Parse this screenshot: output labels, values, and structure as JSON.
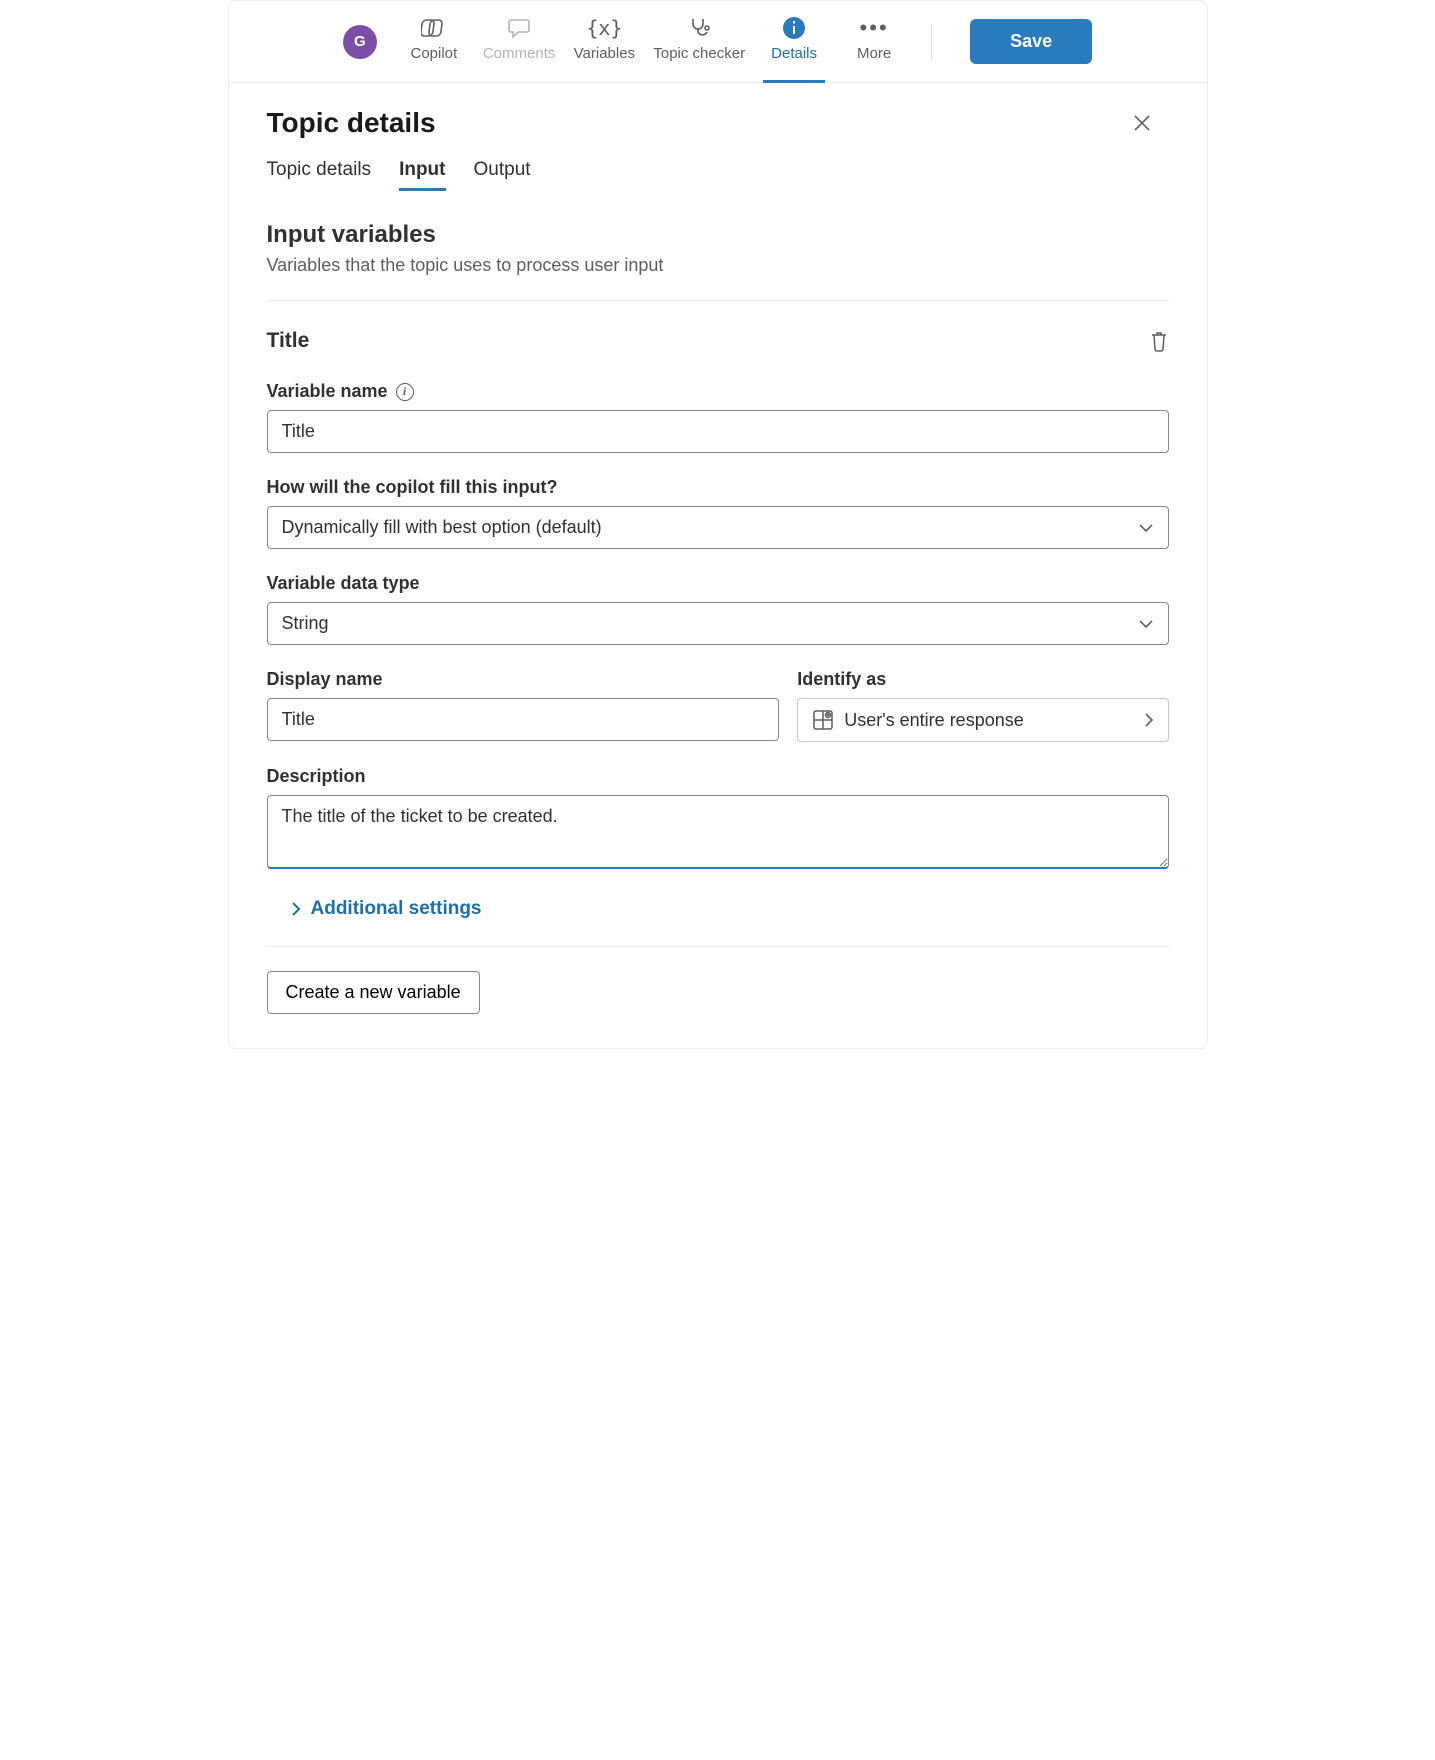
{
  "avatar": {
    "initial": "G"
  },
  "toolbar": {
    "copilot": "Copilot",
    "comments": "Comments",
    "variables": "Variables",
    "topic_checker": "Topic checker",
    "details": "Details",
    "more": "More",
    "save": "Save"
  },
  "panel": {
    "title": "Topic details",
    "tabs": {
      "topic_details": "Topic details",
      "input": "Input",
      "output": "Output"
    },
    "section_heading": "Input variables",
    "section_sub": "Variables that the topic uses to process user input"
  },
  "variable": {
    "title_heading": "Title",
    "variable_name_label": "Variable name",
    "variable_name_value": "Title",
    "fill_label": "How will the copilot fill this input?",
    "fill_value": "Dynamically fill with best option (default)",
    "data_type_label": "Variable data type",
    "data_type_value": "String",
    "display_name_label": "Display name",
    "display_name_value": "Title",
    "identify_label": "Identify as",
    "identify_value": "User's entire response",
    "description_label": "Description",
    "description_value": "The title of the ticket to be created.",
    "additional_settings": "Additional settings",
    "create_new": "Create a new variable"
  }
}
